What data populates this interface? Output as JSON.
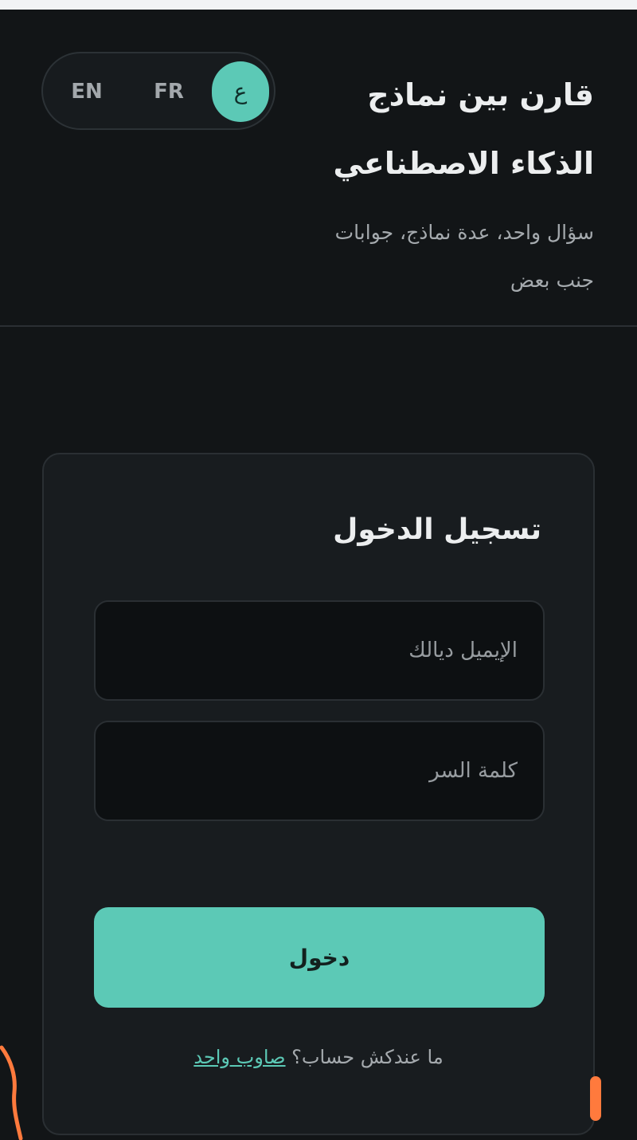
{
  "language_switch": {
    "options": [
      {
        "code": "EN",
        "label": "EN"
      },
      {
        "code": "FR",
        "label": "FR"
      },
      {
        "code": "AR",
        "label": "ع",
        "selected": true
      }
    ]
  },
  "header": {
    "title": "قارن بين نماذج الذكاء الاصطناعي",
    "subtitle": "سؤال واحد، عدة نماذج، جوابات جنب بعض"
  },
  "login": {
    "title": "تسجيل الدخول",
    "email_placeholder": "الإيميل ديالك",
    "password_placeholder": "كلمة السر",
    "submit_label": "دخول",
    "signup_prompt": "ما عندكش حساب؟",
    "signup_link": "صاوب واحد"
  },
  "colors": {
    "accent": "#5cc9b6",
    "background": "#121517",
    "card": "#181c1f",
    "highlight": "#ff7a3d"
  }
}
